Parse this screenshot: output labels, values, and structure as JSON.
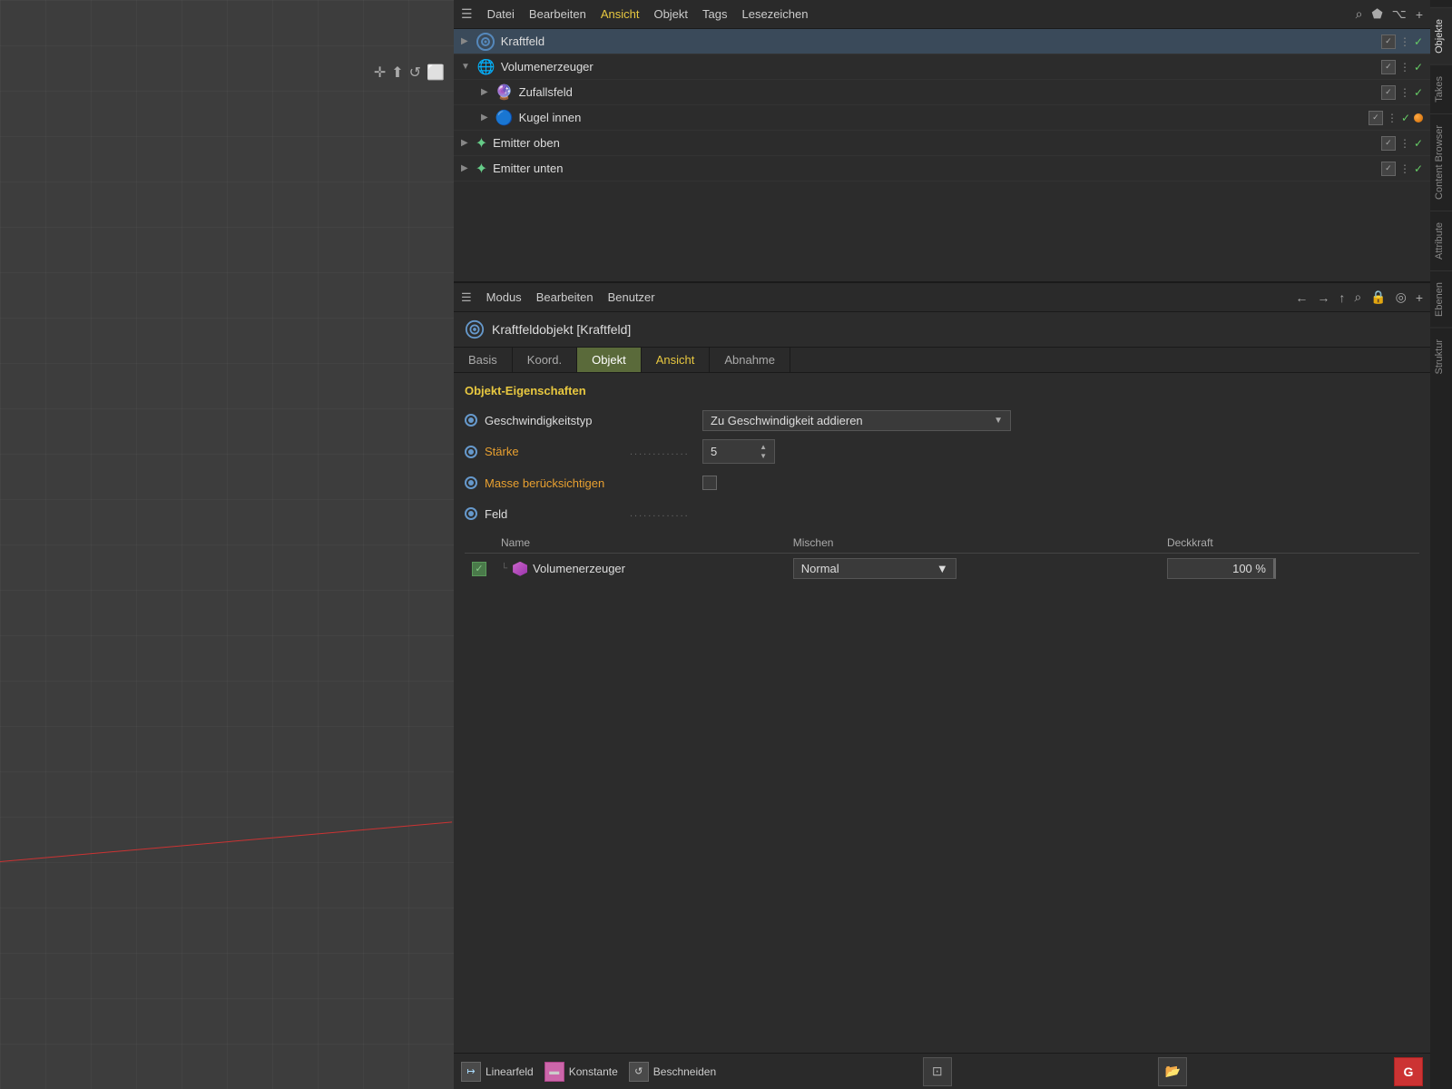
{
  "menubar": {
    "hamburger": "☰",
    "items": [
      {
        "label": "Datei",
        "active": false
      },
      {
        "label": "Bearbeiten",
        "active": false
      },
      {
        "label": "Ansicht",
        "active": true
      },
      {
        "label": "Objekt",
        "active": false
      },
      {
        "label": "Tags",
        "active": false
      },
      {
        "label": "Lesezeichen",
        "active": false
      }
    ],
    "icons": [
      "⌕",
      "⬟",
      "⌥",
      "+"
    ]
  },
  "objects": [
    {
      "id": "kraftfeld",
      "label": "Kraftfeld",
      "indent": 0,
      "expanded": false,
      "icon_type": "target",
      "selected": true
    },
    {
      "id": "volumenerzeuger",
      "label": "Volumenerzeuger",
      "indent": 0,
      "expanded": true,
      "icon_type": "star_purple"
    },
    {
      "id": "zufallsfeld",
      "label": "Zufallsfeld",
      "indent": 1,
      "expanded": false,
      "icon_type": "star_purple2"
    },
    {
      "id": "kugel_innen",
      "label": "Kugel innen",
      "indent": 1,
      "expanded": false,
      "icon_type": "sphere",
      "has_orange_dot": true
    },
    {
      "id": "emitter_oben",
      "label": "Emitter oben",
      "indent": 0,
      "expanded": false,
      "icon_type": "star_green"
    },
    {
      "id": "emitter_unten",
      "label": "Emitter unten",
      "indent": 0,
      "expanded": false,
      "icon_type": "star_green"
    }
  ],
  "attr_menubar": {
    "hamburger": "☰",
    "items": [
      {
        "label": "Modus"
      },
      {
        "label": "Bearbeiten"
      },
      {
        "label": "Benutzer"
      }
    ],
    "icons": [
      "←",
      "→",
      "↑",
      "⌕",
      "🔒",
      "◎",
      "+"
    ]
  },
  "object_title": {
    "text": "Kraftfeldobjekt [Kraftfeld]"
  },
  "tabs": [
    {
      "label": "Basis",
      "active": false
    },
    {
      "label": "Koord.",
      "active": false
    },
    {
      "label": "Objekt",
      "active": true
    },
    {
      "label": "Ansicht",
      "active": false,
      "colored": true
    },
    {
      "label": "Abnahme",
      "active": false
    }
  ],
  "properties": {
    "section_title": "Objekt-Eigenschaften",
    "fields": [
      {
        "id": "geschwindigkeit",
        "label": "Geschwindigkeitstyp",
        "dots": "",
        "type": "dropdown",
        "value": "Zu Geschwindigkeit addieren"
      },
      {
        "id": "staerke",
        "label": "Stärke",
        "dots": ".............",
        "type": "number",
        "value": "5"
      },
      {
        "id": "masse",
        "label": "Masse berücksichtigen",
        "dots": "",
        "type": "checkbox",
        "value": false
      },
      {
        "id": "feld",
        "label": "Feld",
        "dots": ".............",
        "type": "fieldlist"
      }
    ]
  },
  "field_table": {
    "headers": [
      "Name",
      "Mischen",
      "Deckkraft"
    ],
    "rows": [
      {
        "checked": true,
        "name": "Volumenerzeuger",
        "mix": "Normal",
        "opacity": "100 %"
      }
    ]
  },
  "bottom_toolbar": {
    "buttons": [
      {
        "label": "Linearfeld",
        "icon": "↦",
        "active": false
      },
      {
        "label": "Konstante",
        "icon": "▬",
        "active": false,
        "icon_color": "#cc66aa"
      },
      {
        "label": "Beschneiden",
        "icon": "↺",
        "active": false
      }
    ],
    "right_buttons": [
      {
        "id": "select-icon",
        "icon": "⊡"
      },
      {
        "id": "folder-icon",
        "icon": "📁"
      },
      {
        "id": "g-button",
        "icon": "G"
      }
    ]
  },
  "right_sidebar": {
    "tabs": [
      {
        "label": "Objekte",
        "active": true
      },
      {
        "label": "Takes"
      },
      {
        "label": "Content Browser"
      },
      {
        "label": "Attribute",
        "active": false
      },
      {
        "label": "Ebenen"
      },
      {
        "label": "Struktur"
      }
    ]
  }
}
